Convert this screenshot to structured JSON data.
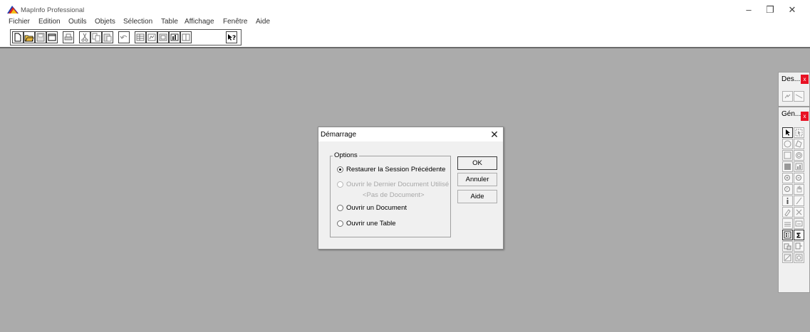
{
  "app": {
    "title": "MapInfo Professional",
    "window_controls": {
      "minimize": "–",
      "restore": "❐",
      "close": "✕"
    }
  },
  "menu": {
    "items": [
      {
        "label": "Fichier"
      },
      {
        "label": "Edition"
      },
      {
        "label": "Outils"
      },
      {
        "label": "Objets"
      },
      {
        "label": "Sélection"
      },
      {
        "label": "Table"
      },
      {
        "label": "Affichage"
      },
      {
        "label": "Fenêtre"
      },
      {
        "label": "Aide"
      }
    ]
  },
  "toolbar": {
    "buttons": [
      {
        "icon": "new-document-icon"
      },
      {
        "icon": "open-folder-icon"
      },
      {
        "icon": "save-icon"
      },
      {
        "icon": "window-icon"
      },
      {
        "icon": "print-icon"
      },
      {
        "icon": "cut-icon"
      },
      {
        "icon": "copy-icon"
      },
      {
        "icon": "paste-icon"
      },
      {
        "icon": "undo-icon"
      },
      {
        "icon": "browser-icon"
      },
      {
        "icon": "map-window-icon"
      },
      {
        "icon": "layout-icon"
      },
      {
        "icon": "graph-icon"
      },
      {
        "icon": "redistricter-icon"
      },
      {
        "icon": "help-pointer-icon"
      }
    ]
  },
  "dialog": {
    "title": "Démarrage",
    "close": "✕",
    "group_label": "Options",
    "options": [
      {
        "label": "Restaurer la Session Précédente",
        "checked": true,
        "enabled": true
      },
      {
        "label": "Ouvrir le Dernier Document Utilisé",
        "checked": false,
        "enabled": false
      },
      {
        "label": "Ouvrir un Document",
        "checked": false,
        "enabled": true
      },
      {
        "label": "Ouvrir une Table",
        "checked": false,
        "enabled": true
      }
    ],
    "last_document_placeholder": "<Pas de Document>",
    "buttons": {
      "ok": "OK",
      "cancel": "Annuler",
      "help": "Aide"
    }
  },
  "palettes": {
    "drawing": {
      "title": "Des...",
      "close": "x",
      "tools": [
        "symbol-tool-icon",
        "line-tool-icon"
      ]
    },
    "main": {
      "title": "Gén...",
      "close": "x",
      "tools": [
        "select-arrow-icon",
        "marquee-select-icon",
        "radius-select-icon",
        "polygon-select-icon",
        "boundary-select-icon",
        "unselect-all-icon",
        "invert-selection-icon",
        "graph-select-icon",
        "zoom-in-icon",
        "zoom-out-icon",
        "change-view-icon",
        "grabber-hand-icon",
        "info-tool-icon",
        "ruler-icon",
        "label-tool-icon",
        "drag-map-icon",
        "layer-control-icon",
        "clip-region-icon",
        "legend-icon",
        "statistics-sigma-icon",
        "hot-link-icon",
        "thematic-map-icon",
        "reshape-icon",
        "clip-edit-icon"
      ]
    }
  }
}
